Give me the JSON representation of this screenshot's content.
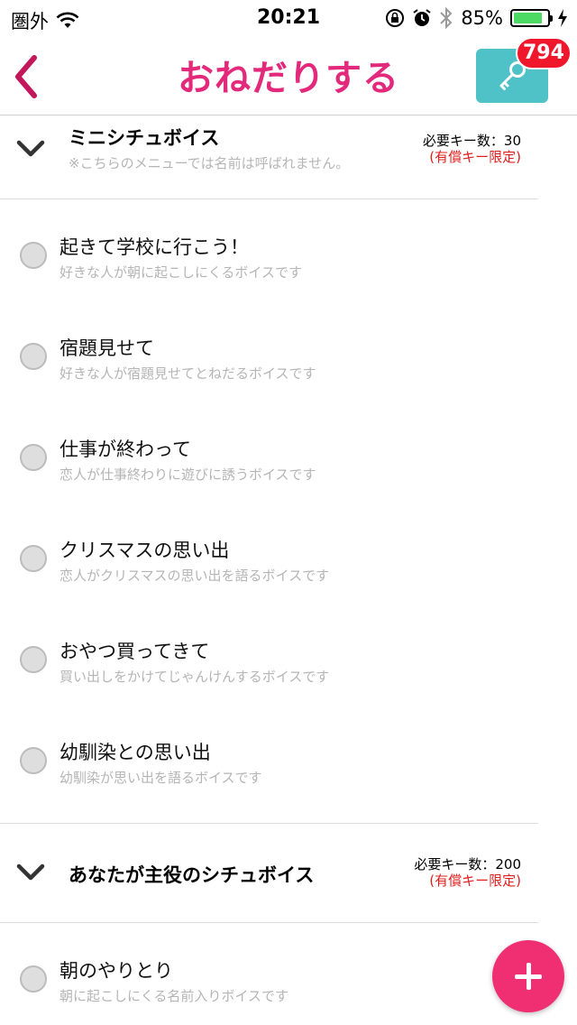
{
  "status_bar": {
    "carrier": "圏外",
    "time": "20:21",
    "battery_percent": "85%",
    "battery_level": 0.85
  },
  "nav": {
    "title": "おねだりする",
    "key_count": "794",
    "accent_color": "#e3297b",
    "key_button_color": "#4ec2c6"
  },
  "sections": [
    {
      "title": "ミニシチュボイス",
      "note": "※こちらのメニューでは名前は呼ばれません。",
      "cost_label": "必要キー数：30",
      "paid_label": "(有償キー限定)",
      "items": [
        {
          "title": "起きて学校に行こう！",
          "desc": "好きな人が朝に起こしにくるボイスです"
        },
        {
          "title": "宿題見せて",
          "desc": "好きな人が宿題見せてとねだるボイスです"
        },
        {
          "title": "仕事が終わって",
          "desc": "恋人が仕事終わりに遊びに誘うボイスです"
        },
        {
          "title": "クリスマスの思い出",
          "desc": "恋人がクリスマスの思い出を語るボイスです"
        },
        {
          "title": "おやつ買ってきて",
          "desc": "買い出しをかけてじゃんけんするボイスです"
        },
        {
          "title": "幼馴染との思い出",
          "desc": "幼馴染が思い出を語るボイスです"
        }
      ]
    },
    {
      "title": "あなたが主役のシチュボイス",
      "cost_label": "必要キー数：200",
      "paid_label": "(有償キー限定)",
      "items": [
        {
          "title": "朝のやりとり",
          "desc": "朝に起こしにくる名前入りボイスです"
        }
      ]
    }
  ],
  "fab": {
    "icon": "plus-icon",
    "color": "#ef2f71"
  }
}
